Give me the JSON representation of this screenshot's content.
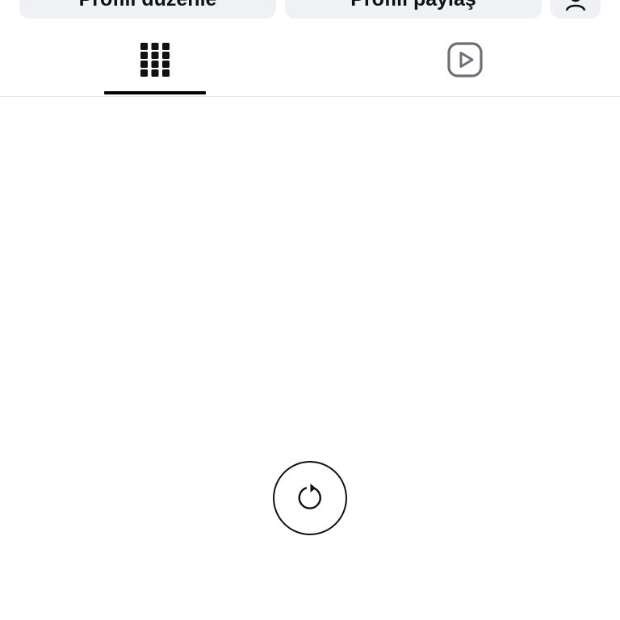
{
  "profile_actions": {
    "edit_label": "Profili düzenle",
    "share_label": "Profili paylaş"
  },
  "tabs": [
    {
      "name": "grid",
      "icon": "grid-icon",
      "active": true
    },
    {
      "name": "reels",
      "icon": "reels-icon",
      "active": false
    }
  ],
  "content": {
    "refresh_icon": "refresh-icon"
  },
  "colors": {
    "button_bg": "#eff1f4",
    "text": "#111111",
    "active_indicator": "#000000",
    "inactive_icon": "#6f6f76",
    "divider": "#e6e6e6"
  }
}
